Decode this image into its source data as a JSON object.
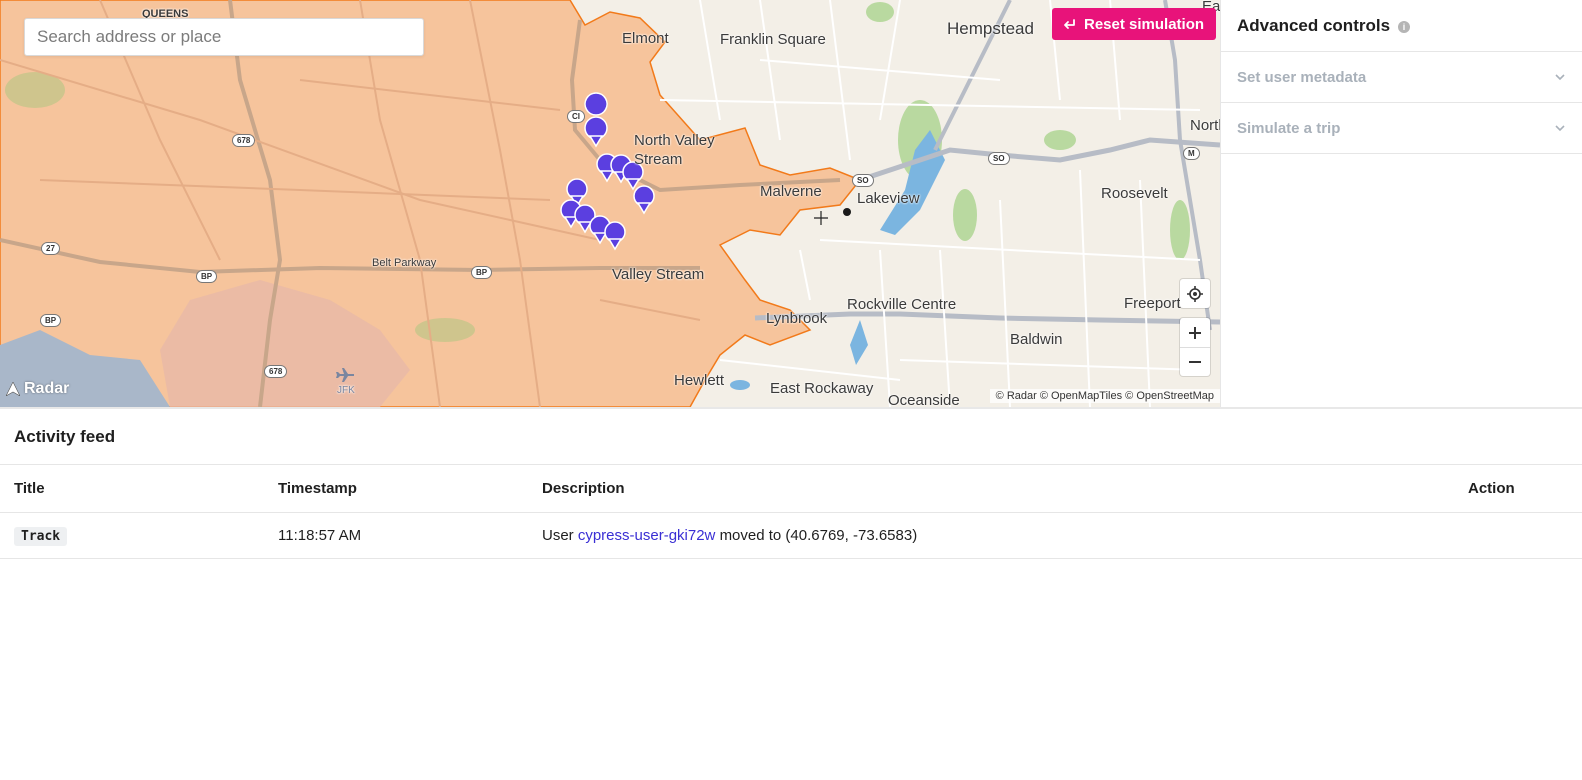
{
  "map": {
    "search_placeholder": "Search address or place",
    "reset_label": "Reset simulation",
    "attribution": "© Radar © OpenMapTiles © OpenStreetMap",
    "brand": "Radar",
    "places": {
      "queens": "QUEENS",
      "elmont": "Elmont",
      "franklin_square": "Franklin Square",
      "hempstead": "Hempstead",
      "north_valley_stream": "North Valley Stream",
      "malverne": "Malverne",
      "lakeview": "Lakeview",
      "roosevelt": "Roosevelt",
      "belt_parkway": "Belt Parkway",
      "valley_stream": "Valley Stream",
      "rockville_centre": "Rockville Centre",
      "freeport": "Freeport",
      "lynbrook": "Lynbrook",
      "baldwin": "Baldwin",
      "hewlett": "Hewlett",
      "east_rockaway": "East Rockaway",
      "oceanside": "Oceanside",
      "jfk": "JFK",
      "north": "North",
      "east": "Ea"
    },
    "shields": {
      "i678_a": "678",
      "i678_b": "678",
      "r27": "27",
      "bp_a": "BP",
      "bp_b": "BP",
      "bp_c": "BP",
      "ci": "CI",
      "so_a": "SO",
      "so_b": "SO",
      "m": "M"
    },
    "colors": {
      "zone_fill": "#f6c49c",
      "zone_border": "#f27a1a",
      "marker": "#5b3fe0",
      "accent": "#e8137a"
    }
  },
  "panel": {
    "title": "Advanced controls",
    "info_icon": "i",
    "sections": [
      {
        "label": "Set user metadata"
      },
      {
        "label": "Simulate a trip"
      }
    ]
  },
  "feed": {
    "title": "Activity feed",
    "columns": [
      "Title",
      "Timestamp",
      "Description",
      "Action"
    ],
    "rows": [
      {
        "title": "Track",
        "timestamp": "11:18:57 AM",
        "desc_prefix": "User",
        "user": "cypress-user-gki72w",
        "desc_suffix": "moved to (40.6769, -73.6583)",
        "action": ""
      }
    ]
  }
}
